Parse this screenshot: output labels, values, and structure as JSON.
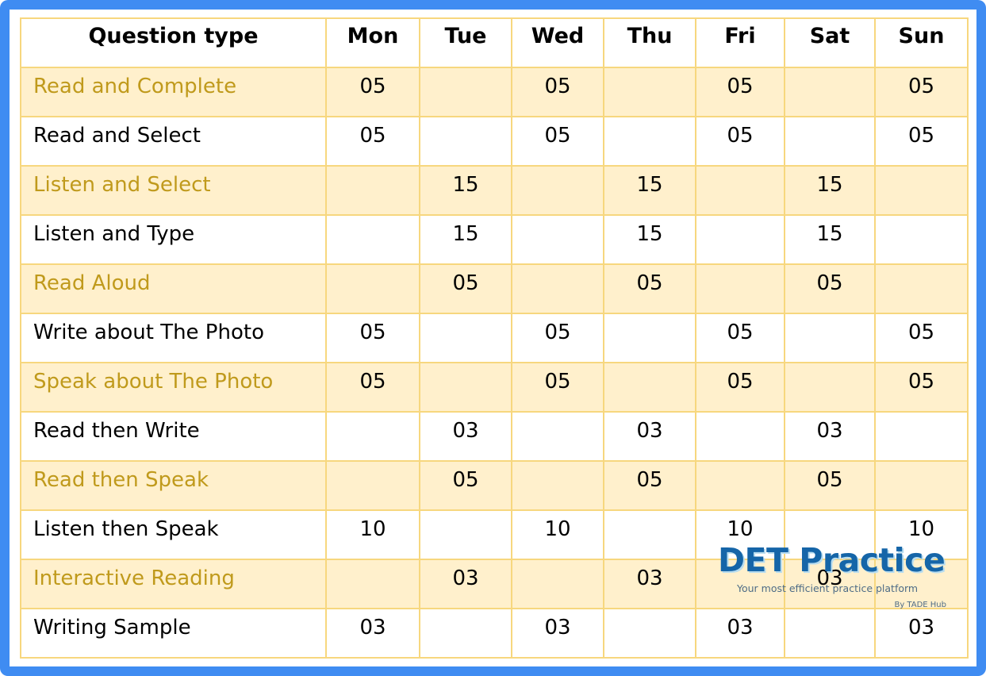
{
  "table": {
    "headers": [
      "Question type",
      "Mon",
      "Tue",
      "Wed",
      "Thu",
      "Fri",
      "Sat",
      "Sun"
    ],
    "rows": [
      {
        "type": "Read and Complete",
        "values": [
          "05",
          "",
          "05",
          "",
          "05",
          "",
          "05"
        ]
      },
      {
        "type": "Read and Select",
        "values": [
          "05",
          "",
          "05",
          "",
          "05",
          "",
          "05"
        ]
      },
      {
        "type": "Listen and Select",
        "values": [
          "",
          "15",
          "",
          "15",
          "",
          "15",
          ""
        ]
      },
      {
        "type": "Listen and Type",
        "values": [
          "",
          "15",
          "",
          "15",
          "",
          "15",
          ""
        ]
      },
      {
        "type": "Read Aloud",
        "values": [
          "",
          "05",
          "",
          "05",
          "",
          "05",
          ""
        ]
      },
      {
        "type": "Write about The Photo",
        "values": [
          "05",
          "",
          "05",
          "",
          "05",
          "",
          "05"
        ]
      },
      {
        "type": "Speak about The Photo",
        "values": [
          "05",
          "",
          "05",
          "",
          "05",
          "",
          "05"
        ]
      },
      {
        "type": "Read then Write",
        "values": [
          "",
          "03",
          "",
          "03",
          "",
          "03",
          ""
        ]
      },
      {
        "type": "Read then Speak",
        "values": [
          "",
          "05",
          "",
          "05",
          "",
          "05",
          ""
        ]
      },
      {
        "type": "Listen then Speak",
        "values": [
          "10",
          "",
          "10",
          "",
          "10",
          "",
          "10"
        ]
      },
      {
        "type": "Interactive Reading",
        "values": [
          "",
          "03",
          "",
          "03",
          "",
          "03",
          ""
        ]
      },
      {
        "type": "Writing Sample",
        "values": [
          "03",
          "",
          "03",
          "",
          "03",
          "",
          "03"
        ]
      }
    ]
  },
  "watermark": {
    "title": "DET Practice",
    "tagline": "Your most efficient practice platform",
    "byline": "By TADE Hub"
  },
  "colors": {
    "frame_border": "#3f8cf2",
    "grid_line": "#f7d77e",
    "shaded_row_bg": "#fff0cc",
    "shaded_row_text": "#c09a1c",
    "logo_blue": "#1565a8"
  }
}
